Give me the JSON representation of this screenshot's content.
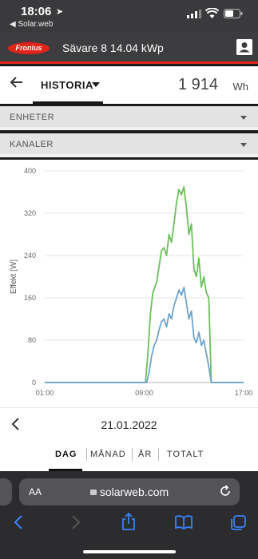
{
  "status_bar": {
    "time": "18:06",
    "back_app": "◀ Solar.web"
  },
  "header": {
    "system_title": "Sävare 8 14.04 kWp",
    "logo_text": "Fronius"
  },
  "tabs": {
    "historia_label": "HISTORIA",
    "energy_value": "1 914",
    "energy_unit": "Wh"
  },
  "dropdowns": {
    "enheter": "ENHETER",
    "kanaler": "KANALER"
  },
  "colors": {
    "green_series": "#6cbf5b",
    "blue_series": "#6fa3cc",
    "accent_red": "#e2231a"
  },
  "chart_data": {
    "type": "line",
    "xlabel": "",
    "ylabel": "Effekt [W]",
    "ylim": [
      0,
      400
    ],
    "yticks": [
      0,
      80,
      160,
      240,
      320,
      400
    ],
    "xticks": [
      "01:00",
      "09:00",
      "17:00"
    ],
    "xlim_hours": [
      1,
      17
    ],
    "series": [
      {
        "name": "",
        "color": "#6cbf5b",
        "x": [
          1,
          9.1,
          9.3,
          9.5,
          9.7,
          10.0,
          10.2,
          10.4,
          10.6,
          10.8,
          11.0,
          11.2,
          11.4,
          11.6,
          11.8,
          12.0,
          12.2,
          12.4,
          12.6,
          12.8,
          13.0,
          13.2,
          13.4,
          13.6,
          13.8,
          14.0,
          14.2,
          14.4,
          14.6,
          17
        ],
        "y": [
          0,
          0,
          55,
          130,
          170,
          190,
          220,
          250,
          255,
          240,
          280,
          265,
          300,
          340,
          365,
          355,
          370,
          330,
          280,
          300,
          215,
          200,
          235,
          180,
          200,
          170,
          160,
          0,
          0,
          0
        ]
      },
      {
        "name": "",
        "color": "#6fa3cc",
        "x": [
          1,
          9.2,
          9.4,
          9.6,
          9.8,
          10.0,
          10.2,
          10.4,
          10.6,
          10.8,
          11.0,
          11.2,
          11.4,
          11.6,
          11.8,
          12.0,
          12.2,
          12.4,
          12.6,
          12.8,
          13.0,
          13.2,
          13.4,
          13.6,
          13.8,
          14.0,
          14.2,
          14.4,
          14.6,
          17
        ],
        "y": [
          0,
          0,
          20,
          50,
          70,
          80,
          100,
          115,
          120,
          105,
          130,
          120,
          145,
          160,
          175,
          165,
          180,
          150,
          120,
          135,
          85,
          75,
          95,
          70,
          80,
          55,
          30,
          0,
          0,
          0
        ]
      }
    ]
  },
  "date_nav": {
    "date": "21.01.2022"
  },
  "period_tabs": [
    "DAG",
    "MÅNAD",
    "ÅR",
    "TOTALT"
  ],
  "safari": {
    "aa": "AA",
    "url": "solarweb.com"
  }
}
